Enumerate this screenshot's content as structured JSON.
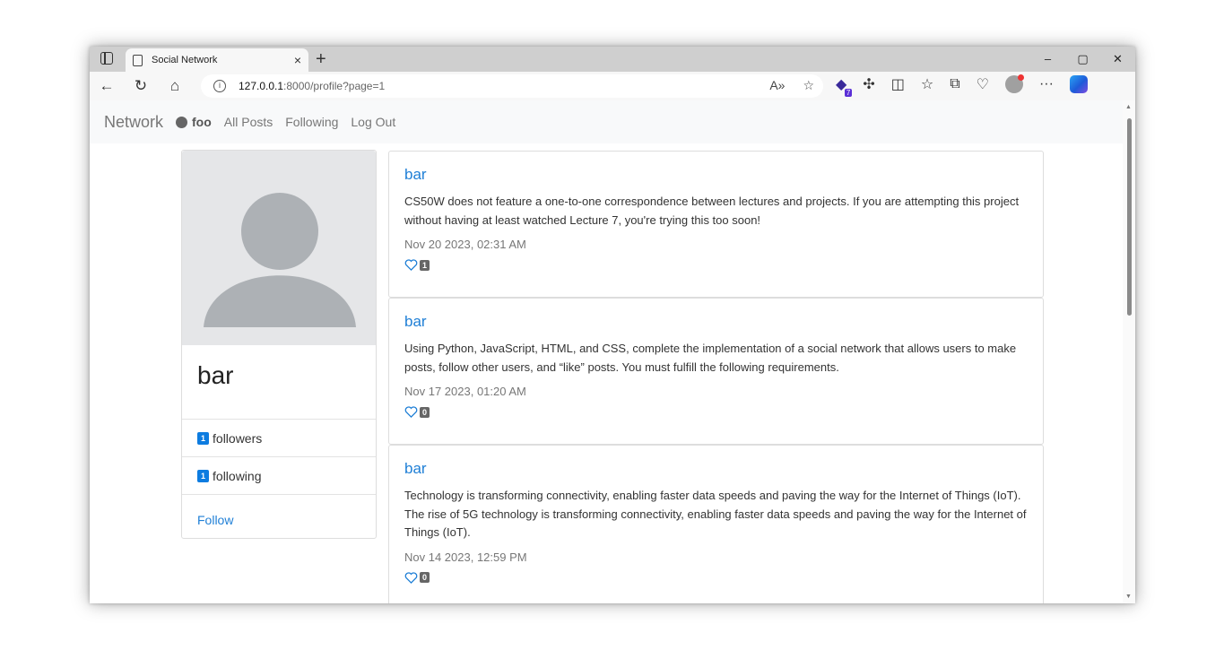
{
  "browser": {
    "tab_title": "Social Network",
    "tab_close": "×",
    "new_tab": "+",
    "window_controls": [
      "–",
      "▢",
      "✕"
    ],
    "url_host": "127.0.0.1",
    "url_path": ":8000/profile?page=1",
    "extension_badge": "7"
  },
  "navbar": {
    "brand": "Network",
    "username": "foo",
    "links": [
      "All Posts",
      "Following",
      "Log Out"
    ]
  },
  "profile": {
    "name": "bar",
    "followers_count": "1",
    "followers_label": "followers",
    "following_count": "1",
    "following_label": "following",
    "follow_label": "Follow"
  },
  "posts": [
    {
      "author": "bar",
      "content": "CS50W does not feature a one-to-one correspondence between lectures and projects. If you are attempting this project without having at least watched Lecture 7, you're trying this too soon!",
      "date": "Nov 20 2023, 02:31 AM",
      "likes": "1"
    },
    {
      "author": "bar",
      "content": "Using Python, JavaScript, HTML, and CSS, complete the implementation of a social network that allows users to make posts, follow other users, and “like” posts. You must fulfill the following requirements.",
      "date": "Nov 17 2023, 01:20 AM",
      "likes": "0"
    },
    {
      "author": "bar",
      "content": "Technology is transforming connectivity, enabling faster data speeds and paving the way for the Internet of Things (IoT). The rise of 5G technology is transforming connectivity, enabling faster data speeds and paving the way for the Internet of Things (IoT).",
      "date": "Nov 14 2023, 12:59 PM",
      "likes": "0"
    }
  ]
}
